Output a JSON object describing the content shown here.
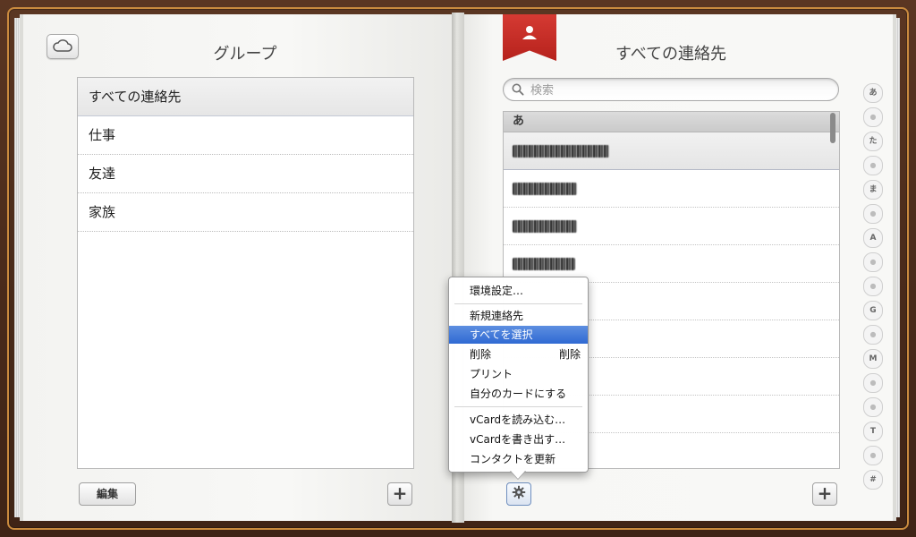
{
  "groups_page": {
    "title": "グループ",
    "items": [
      {
        "label": "すべての連絡先",
        "selected": true
      },
      {
        "label": "仕事"
      },
      {
        "label": "友達"
      },
      {
        "label": "家族"
      }
    ],
    "edit_label": "編集",
    "add_label": "+"
  },
  "contacts_page": {
    "title": "すべての連絡先",
    "search_placeholder": "検索",
    "section_header": "あ",
    "add_label": "+"
  },
  "index": [
    "あ",
    "●",
    "た",
    "●",
    "ま",
    "●",
    "A",
    "●",
    "●",
    "G",
    "●",
    "M",
    "●",
    "●",
    "T",
    "●",
    "#"
  ],
  "menu": {
    "items": {
      "preferences": "環境設定…",
      "new_contact": "新規連絡先",
      "select_all": "すべてを選択",
      "delete": "削除",
      "delete_shortcut": "削除",
      "print": "プリント",
      "make_my_card": "自分のカードにする",
      "import_vcard": "vCardを読み込む…",
      "export_vcard": "vCardを書き出す…",
      "refresh_contacts": "コンタクトを更新"
    }
  },
  "colors": {
    "cover": "#4a2c1c",
    "stitch": "#c98a3e",
    "bookmark": "#c82c25",
    "menu_highlight": "#2f69d3"
  }
}
